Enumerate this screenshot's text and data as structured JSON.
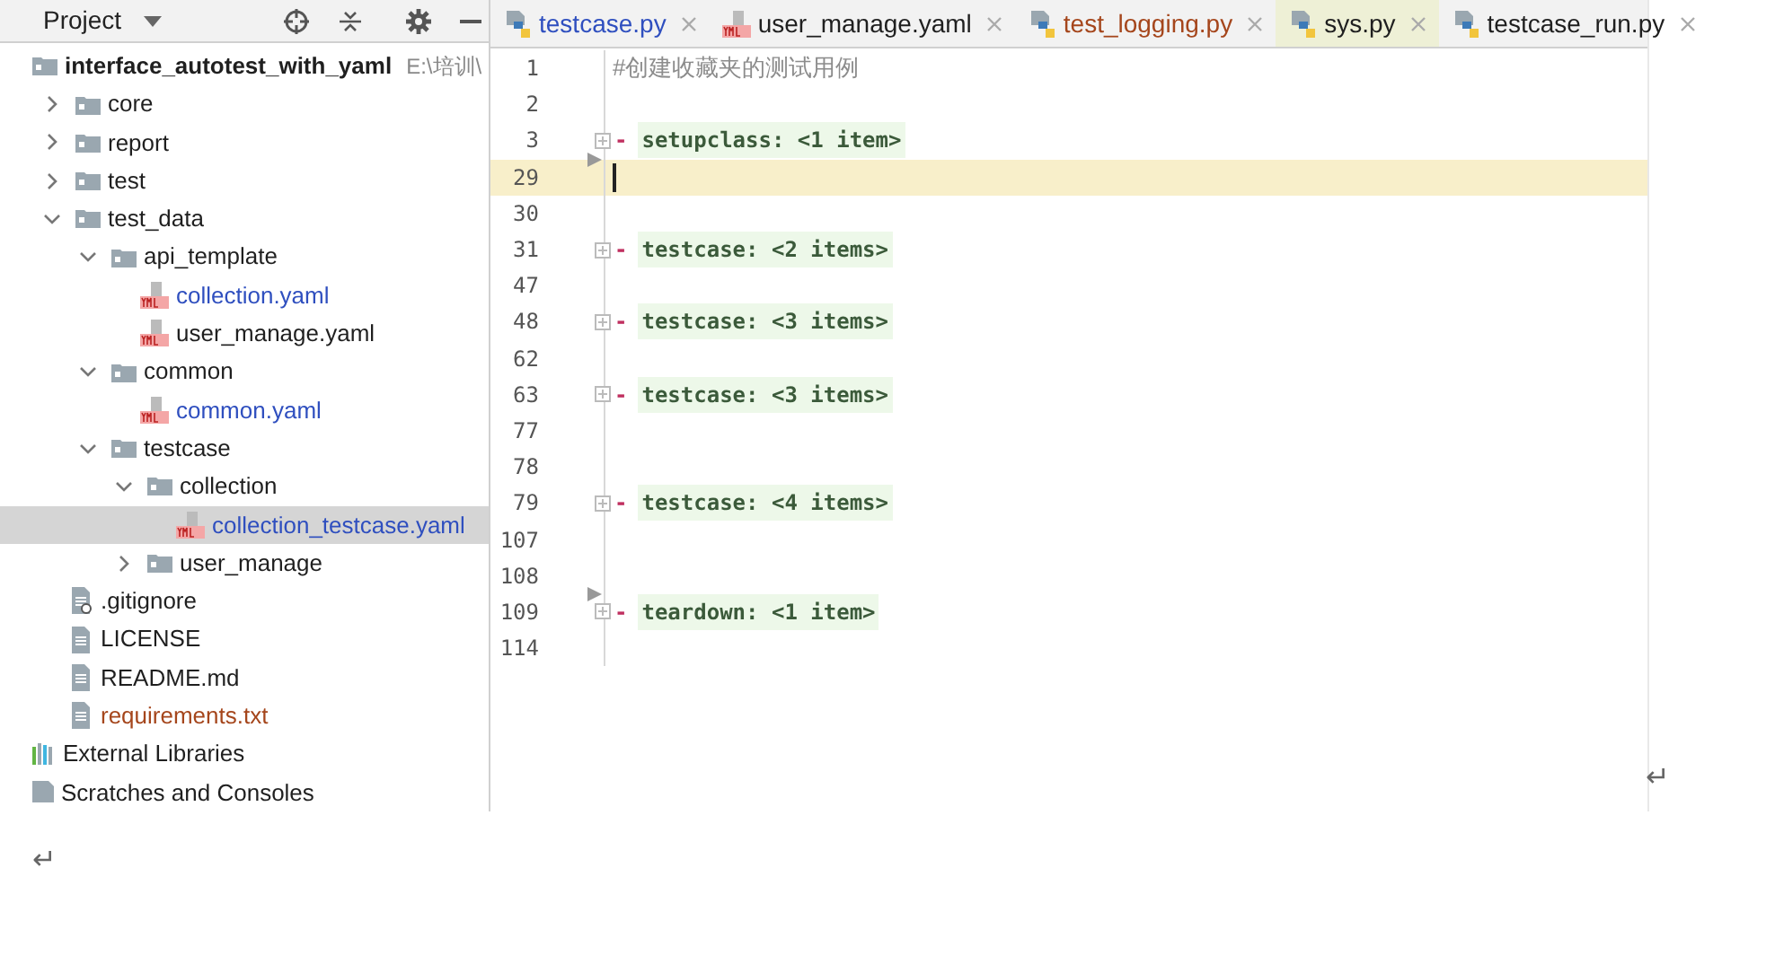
{
  "project_panel": {
    "title": "Project",
    "tree": [
      {
        "label": "interface_autotest_with_yaml",
        "path": "E:\\培训\\",
        "kind": "root",
        "expanded": true,
        "selected": false,
        "children": [
          {
            "label": "core",
            "kind": "folder",
            "expanded": false,
            "selected": false
          },
          {
            "label": "report",
            "kind": "folder",
            "expanded": false,
            "selected": false
          },
          {
            "label": "test",
            "kind": "folder",
            "expanded": false,
            "selected": false
          },
          {
            "label": "test_data",
            "kind": "folder",
            "expanded": true,
            "selected": false,
            "children": [
              {
                "label": "api_template",
                "kind": "folder",
                "expanded": true,
                "selected": false,
                "children": [
                  {
                    "label": "collection.yaml",
                    "kind": "yaml",
                    "color": "#2f4fbf",
                    "selected": false
                  },
                  {
                    "label": "user_manage.yaml",
                    "kind": "yaml",
                    "color": "#1f1f1f",
                    "selected": false
                  }
                ]
              },
              {
                "label": "common",
                "kind": "folder",
                "expanded": true,
                "selected": false,
                "children": [
                  {
                    "label": "common.yaml",
                    "kind": "yaml",
                    "color": "#2f4fbf",
                    "selected": false
                  }
                ]
              },
              {
                "label": "testcase",
                "kind": "folder",
                "expanded": true,
                "selected": false,
                "children": [
                  {
                    "label": "collection",
                    "kind": "folder",
                    "expanded": true,
                    "selected": false,
                    "children": [
                      {
                        "label": "collection_testcase.yaml",
                        "kind": "yaml",
                        "color": "#2f4fbf",
                        "selected": true
                      }
                    ]
                  },
                  {
                    "label": "user_manage",
                    "kind": "folder",
                    "expanded": false,
                    "selected": false
                  }
                ]
              }
            ]
          },
          {
            "label": ".gitignore",
            "kind": "ignore",
            "color": "#1f1f1f",
            "selected": false
          },
          {
            "label": "LICENSE",
            "kind": "text",
            "color": "#1f1f1f",
            "selected": false
          },
          {
            "label": "README.md",
            "kind": "text",
            "color": "#1f1f1f",
            "selected": false
          },
          {
            "label": "requirements.txt",
            "kind": "text",
            "color": "#a5461c",
            "selected": false
          }
        ]
      },
      {
        "label": "External Libraries",
        "kind": "library",
        "selected": false
      },
      {
        "label": "Scratches and Consoles",
        "kind": "scratch",
        "selected": false
      }
    ]
  },
  "tabs": [
    {
      "label": "testcase.py",
      "kind": "python",
      "color": "#2f4fbf",
      "selected": false
    },
    {
      "label": "user_manage.yaml",
      "kind": "yaml",
      "color": "#1f1f1f",
      "selected": false
    },
    {
      "label": "test_logging.py",
      "kind": "python",
      "color": "#a5461c",
      "selected": false
    },
    {
      "label": "sys.py",
      "kind": "python",
      "color": "#1f1f1f",
      "selected": true
    },
    {
      "label": "testcase_run.py",
      "kind": "python",
      "color": "#1f1f1f",
      "selected": false
    }
  ],
  "editor": {
    "lines": [
      {
        "number": "1",
        "kind": "comment",
        "text": "#创建收藏夹的测试用例",
        "current": false,
        "arrow": false
      },
      {
        "number": "2",
        "kind": "blank",
        "current": false,
        "arrow": false
      },
      {
        "number": "3",
        "kind": "fold",
        "dash": "-",
        "text": "setupclass: <1 item>",
        "current": false,
        "arrow": false
      },
      {
        "number": "29",
        "kind": "blank",
        "current": true,
        "arrow": true
      },
      {
        "number": "30",
        "kind": "blank",
        "current": false,
        "arrow": false
      },
      {
        "number": "31",
        "kind": "fold",
        "dash": "-",
        "text": "testcase: <2 items>",
        "current": false,
        "arrow": false
      },
      {
        "number": "47",
        "kind": "blank",
        "current": false,
        "arrow": false
      },
      {
        "number": "48",
        "kind": "fold",
        "dash": "-",
        "text": "testcase: <3 items>",
        "current": false,
        "arrow": false
      },
      {
        "number": "62",
        "kind": "blank",
        "current": false,
        "arrow": false
      },
      {
        "number": "63",
        "kind": "fold",
        "dash": "-",
        "text": "testcase: <3 items>",
        "current": false,
        "arrow": false
      },
      {
        "number": "77",
        "kind": "blank",
        "current": false,
        "arrow": false
      },
      {
        "number": "78",
        "kind": "blank",
        "current": false,
        "arrow": false
      },
      {
        "number": "79",
        "kind": "fold",
        "dash": "-",
        "text": "testcase: <4 items>",
        "current": false,
        "arrow": false
      },
      {
        "number": "107",
        "kind": "blank",
        "current": false,
        "arrow": false
      },
      {
        "number": "108",
        "kind": "blank",
        "current": false,
        "arrow": false
      },
      {
        "number": "109",
        "kind": "fold",
        "dash": "-",
        "text": "teardown: <1 item>",
        "current": false,
        "arrow": true
      },
      {
        "number": "114",
        "kind": "blank",
        "current": false,
        "arrow": false
      }
    ]
  },
  "paragraph_marks": [
    "↵",
    "↵"
  ]
}
